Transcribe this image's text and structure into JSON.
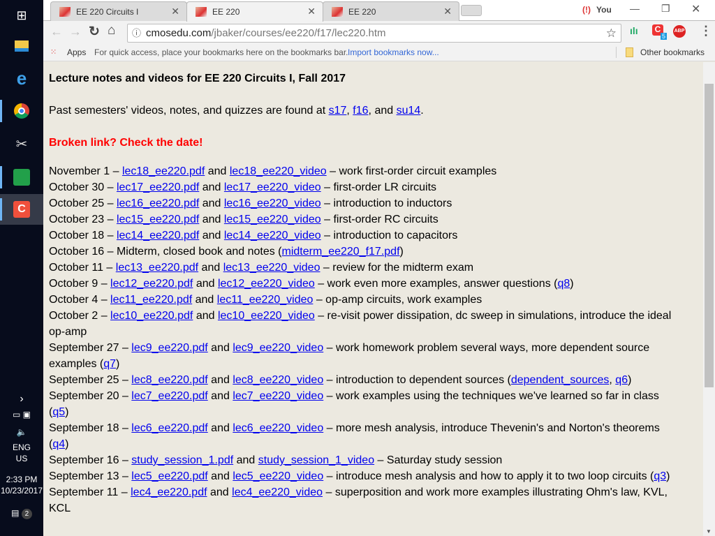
{
  "browser": {
    "tabs": [
      {
        "title": "EE 220 Circuits I"
      },
      {
        "title": "EE 220"
      },
      {
        "title": "EE 220"
      }
    ],
    "url_host": "cmosedu.com",
    "url_path": "/jbaker/courses/ee220/f17/lec220.htm",
    "profile": "You",
    "extension_badge": "5",
    "abp_label": "ABP",
    "bookmarks": {
      "apps": "Apps",
      "hint": "For quick access, place your bookmarks here on the bookmarks bar.",
      "import": "Import bookmarks now...",
      "other": "Other bookmarks"
    }
  },
  "taskbar": {
    "lang": "ENG",
    "region": "US",
    "time": "2:33 PM",
    "date": "10/23/2017",
    "notifications": "2"
  },
  "page": {
    "title": "Lecture notes and videos for EE 220 Circuits I, Fall 2017",
    "past": [
      {
        "t": "Past semesters' videos, notes, and quizzes are found at "
      },
      {
        "l": "s17"
      },
      {
        "t": ", "
      },
      {
        "l": "f16"
      },
      {
        "t": ", and "
      },
      {
        "l": "su14"
      },
      {
        "t": "."
      }
    ],
    "broken": "Broken link? Check the date!",
    "entries": [
      [
        {
          "t": "November 1 – "
        },
        {
          "l": "lec18_ee220.pdf"
        },
        {
          "t": " and "
        },
        {
          "l": "lec18_ee220_video"
        },
        {
          "t": " – work first-order circuit examples"
        }
      ],
      [
        {
          "t": "October 30 – "
        },
        {
          "l": "lec17_ee220.pdf"
        },
        {
          "t": " and "
        },
        {
          "l": "lec17_ee220_video"
        },
        {
          "t": " – first-order LR circuits"
        }
      ],
      [
        {
          "t": "October 25 – "
        },
        {
          "l": "lec16_ee220.pdf"
        },
        {
          "t": " and "
        },
        {
          "l": "lec16_ee220_video"
        },
        {
          "t": " – introduction to inductors"
        }
      ],
      [
        {
          "t": "October 23 – "
        },
        {
          "l": "lec15_ee220.pdf"
        },
        {
          "t": " and "
        },
        {
          "l": "lec15_ee220_video"
        },
        {
          "t": " – first-order RC circuits"
        }
      ],
      [
        {
          "t": "October 18 – "
        },
        {
          "l": "lec14_ee220.pdf"
        },
        {
          "t": " and "
        },
        {
          "l": "lec14_ee220_video"
        },
        {
          "t": " – introduction to capacitors"
        }
      ],
      [
        {
          "t": "October 16 – Midterm, closed book and notes ("
        },
        {
          "l": "midterm_ee220_f17.pdf"
        },
        {
          "t": ")"
        }
      ],
      [
        {
          "t": "October 11 – "
        },
        {
          "l": "lec13_ee220.pdf"
        },
        {
          "t": " and "
        },
        {
          "l": "lec13_ee220_video"
        },
        {
          "t": " – review for the midterm exam"
        }
      ],
      [
        {
          "t": "October 9 – "
        },
        {
          "l": "lec12_ee220.pdf"
        },
        {
          "t": " and "
        },
        {
          "l": "lec12_ee220_video"
        },
        {
          "t": " – work even more examples, answer questions ("
        },
        {
          "l": "q8"
        },
        {
          "t": ")"
        }
      ],
      [
        {
          "t": "October 4 – "
        },
        {
          "l": "lec11_ee220.pdf"
        },
        {
          "t": " and "
        },
        {
          "l": "lec11_ee220_video"
        },
        {
          "t": " – op-amp circuits, work examples"
        }
      ],
      [
        {
          "t": "October 2 – "
        },
        {
          "l": "lec10_ee220.pdf"
        },
        {
          "t": " and "
        },
        {
          "l": "lec10_ee220_video"
        },
        {
          "t": " – re-visit power dissipation, dc sweep in simulations, introduce the ideal op-amp"
        }
      ],
      [
        {
          "t": "September 27 – "
        },
        {
          "l": "lec9_ee220.pdf"
        },
        {
          "t": " and "
        },
        {
          "l": "lec9_ee220_video"
        },
        {
          "t": " – work homework problem several ways, more dependent source examples ("
        },
        {
          "l": "q7"
        },
        {
          "t": ")"
        }
      ],
      [
        {
          "t": "September 25 – "
        },
        {
          "l": "lec8_ee220.pdf"
        },
        {
          "t": " and "
        },
        {
          "l": "lec8_ee220_video"
        },
        {
          "t": " – introduction to dependent sources ("
        },
        {
          "l": "dependent_sources"
        },
        {
          "t": ", "
        },
        {
          "l": "q6"
        },
        {
          "t": ")"
        }
      ],
      [
        {
          "t": "September 20 – "
        },
        {
          "l": "lec7_ee220.pdf"
        },
        {
          "t": " and "
        },
        {
          "l": "lec7_ee220_video"
        },
        {
          "t": " – work examples using the techniques we've learned so far in class ("
        },
        {
          "l": "q5"
        },
        {
          "t": ")"
        }
      ],
      [
        {
          "t": "September 18 – "
        },
        {
          "l": "lec6_ee220.pdf"
        },
        {
          "t": " and "
        },
        {
          "l": "lec6_ee220_video"
        },
        {
          "t": " – more mesh analysis, introduce Thevenin's and Norton's theorems ("
        },
        {
          "l": "q4"
        },
        {
          "t": ")"
        }
      ],
      [
        {
          "t": "September 16 – "
        },
        {
          "l": "study_session_1.pdf"
        },
        {
          "t": " and "
        },
        {
          "l": "study_session_1_video"
        },
        {
          "t": " – Saturday study session"
        }
      ],
      [
        {
          "t": "September 13 – "
        },
        {
          "l": "lec5_ee220.pdf"
        },
        {
          "t": " and "
        },
        {
          "l": "lec5_ee220_video"
        },
        {
          "t": " – introduce mesh analysis and how to apply it to two loop circuits ("
        },
        {
          "l": "q3"
        },
        {
          "t": ")"
        }
      ],
      [
        {
          "t": "September 11 – "
        },
        {
          "l": "lec4_ee220.pdf"
        },
        {
          "t": " and "
        },
        {
          "l": "lec4_ee220_video"
        },
        {
          "t": " – superposition and work more examples illustrating Ohm's law, KVL, KCL"
        }
      ]
    ]
  }
}
